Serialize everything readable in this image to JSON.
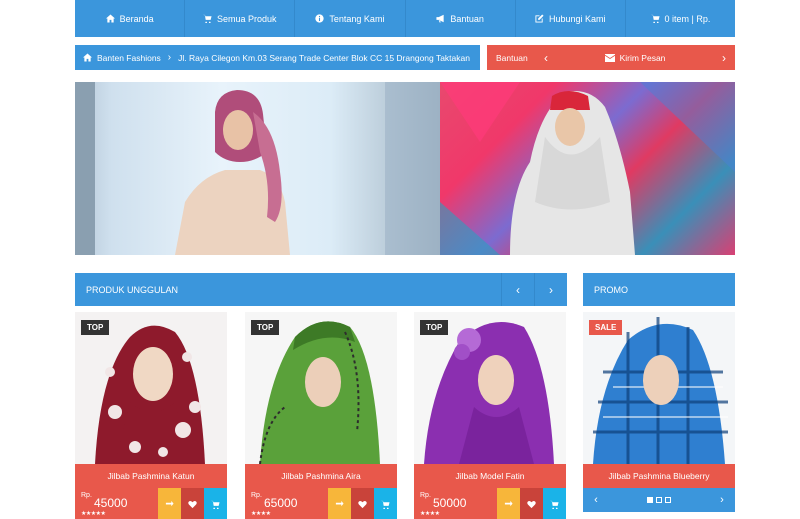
{
  "nav": {
    "items": [
      {
        "label": "Beranda",
        "icon": "home-icon"
      },
      {
        "label": "Semua Produk",
        "icon": "cart-icon"
      },
      {
        "label": "Tentang Kami",
        "icon": "info-icon"
      },
      {
        "label": "Bantuan",
        "icon": "bullhorn-icon"
      },
      {
        "label": "Hubungi Kami",
        "icon": "edit-icon"
      },
      {
        "label": "0 item | Rp.",
        "icon": "cart-icon"
      }
    ]
  },
  "breadcrumb": {
    "home": "Banten Fashions",
    "address": "Jl. Raya Cilegon Km.03 Serang Trade Center Blok CC 15 Drangong Taktakan"
  },
  "help": {
    "label": "Bantuan",
    "message": "Kirim Pesan"
  },
  "sections": {
    "featured_title": "PRODUK UNGGULAN",
    "promo_title": "PROMO"
  },
  "products": [
    {
      "tag": "TOP",
      "name": "Jilbab Pashmina Katun",
      "currency": "Rp.",
      "price": "45000",
      "stars": "★★★★★"
    },
    {
      "tag": "TOP",
      "name": "Jilbab Pashmina Aira",
      "currency": "Rp.",
      "price": "65000",
      "stars": "★★★★"
    },
    {
      "tag": "TOP",
      "name": "Jilbab Model Fatin",
      "currency": "Rp.",
      "price": "50000",
      "stars": "★★★★"
    }
  ],
  "promo": {
    "tag": "SALE",
    "name": "Jilbab Pashmina Blueberry"
  },
  "colors": {
    "primary_blue": "#3b96dc",
    "accent_red": "#e8584b",
    "compare_orange": "#f7b63a",
    "wishlist_red": "#c9433a",
    "cart_cyan": "#1ab3e8"
  }
}
